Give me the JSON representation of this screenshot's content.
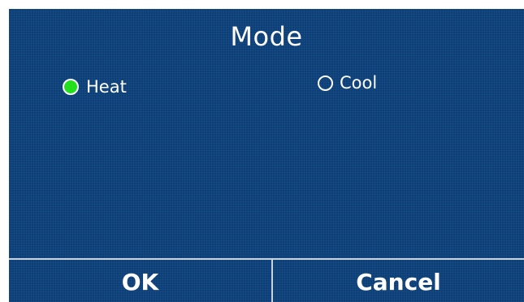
{
  "screen": {
    "title": "Mode"
  },
  "mode_options": [
    {
      "label": "Heat",
      "selected": true
    },
    {
      "label": "Cool",
      "selected": false
    }
  ],
  "buttons": {
    "ok_label": "OK",
    "cancel_label": "Cancel"
  },
  "colors": {
    "background": "#0b3f78",
    "selected_radio": "#22e01c",
    "text": "#ffffff",
    "divider": "#c9d3de"
  }
}
